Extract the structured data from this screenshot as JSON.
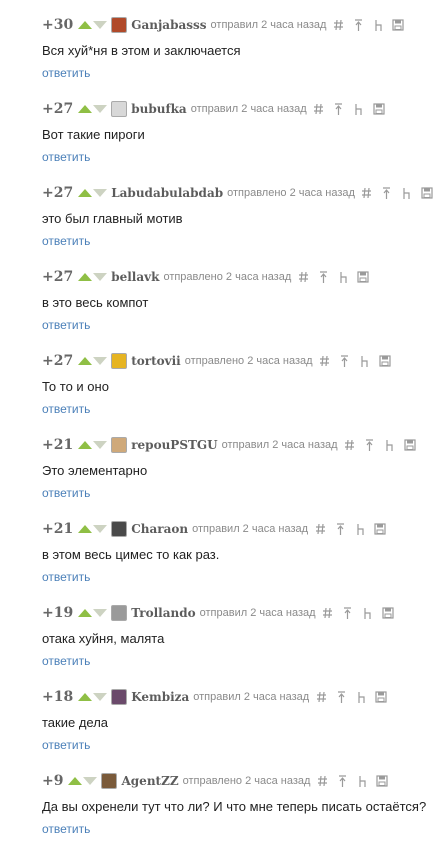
{
  "reply_label": "ответить",
  "comments": [
    {
      "rating": "+30",
      "author": "Ganjabasss",
      "meta": "отправил 2 часа назад",
      "text": "Вся хуй*ня в этом и заключается",
      "avatar_color": "#b04a2a"
    },
    {
      "rating": "+27",
      "author": "bubufka",
      "meta": "отправил 2 часа назад",
      "text": "Вот такие пироги",
      "avatar_color": "#d8d8d8"
    },
    {
      "rating": "+27",
      "author": "Labudabulabdab",
      "meta": "отправлено 2 часа назад",
      "text": "это был главный мотив",
      "avatar_color": ""
    },
    {
      "rating": "+27",
      "author": "bellavk",
      "meta": "отправлено 2 часа назад",
      "text": "в это весь компот",
      "avatar_color": ""
    },
    {
      "rating": "+27",
      "author": "tortovii",
      "meta": "отправлено 2 часа назад",
      "text": "То то и оно",
      "avatar_color": "#e6b422"
    },
    {
      "rating": "+21",
      "author": "repouPSTGU",
      "meta": "отправил 2 часа назад",
      "text": "Это элементарно",
      "avatar_color": "#cfa97a"
    },
    {
      "rating": "+21",
      "author": "Charaon",
      "meta": "отправил 2 часа назад",
      "text": "в этом весь цимес то как раз.",
      "avatar_color": "#4a4a4a"
    },
    {
      "rating": "+19",
      "author": "Trollando",
      "meta": "отправил 2 часа назад",
      "text": "отака хуйня, малята",
      "avatar_color": "#9a9a9a"
    },
    {
      "rating": "+18",
      "author": "Kembiza",
      "meta": "отправил 2 часа назад",
      "text": "такие дела",
      "avatar_color": "#6b4a6b"
    },
    {
      "rating": "+9",
      "author": "AgentZZ",
      "meta": "отправлено 2 часа назад",
      "text": "Да вы охренели тут что ли? И что мне теперь писать остаётся?",
      "avatar_color": "#7a5a3a"
    }
  ],
  "icons": {
    "rating_up": "arrow-up-icon",
    "rating_down": "arrow-down-icon",
    "link": "hash-icon",
    "to_parent": "arrow-up-line-icon",
    "reply_branch": "branch-icon",
    "save": "floppy-icon"
  },
  "colors": {
    "vote_up": "#8fbf45",
    "vote_down": "#cdd3c2",
    "reply_link": "#4a7fb8",
    "author": "#5c5c5c",
    "meta": "#8a8a8a"
  }
}
